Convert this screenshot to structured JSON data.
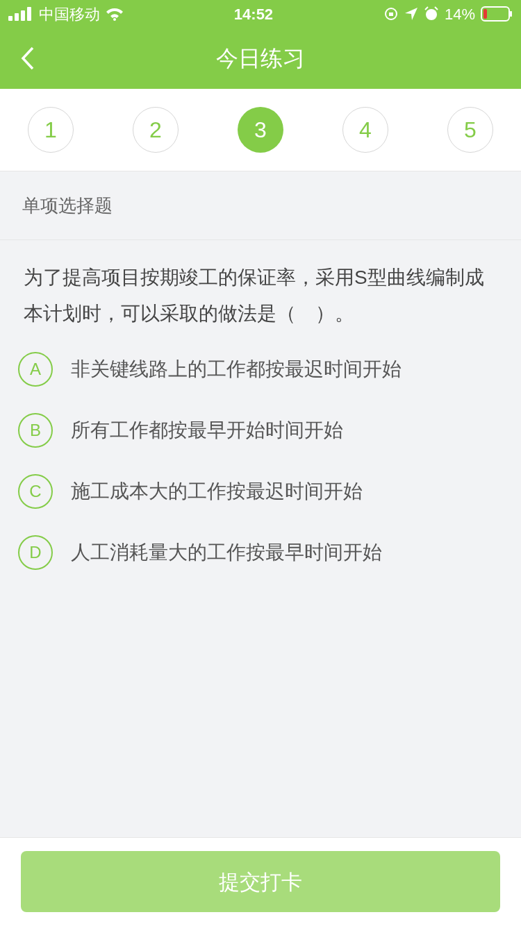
{
  "status_bar": {
    "carrier": "中国移动",
    "time": "14:52",
    "battery": "14%"
  },
  "header": {
    "title": "今日练习"
  },
  "steps": [
    {
      "label": "1",
      "selected": false
    },
    {
      "label": "2",
      "selected": false
    },
    {
      "label": "3",
      "selected": true
    },
    {
      "label": "4",
      "selected": false
    },
    {
      "label": "5",
      "selected": false
    }
  ],
  "question": {
    "type": "单项选择题",
    "text": "为了提高项目按期竣工的保证率，采用S型曲线编制成本计划时，可以采取的做法是（　）。",
    "options": [
      {
        "letter": "A",
        "text": "非关键线路上的工作都按最迟时间开始",
        "selected": false
      },
      {
        "letter": "B",
        "text": "所有工作都按最早开始时间开始",
        "selected": false
      },
      {
        "letter": "C",
        "text": "施工成本大的工作按最迟时间开始",
        "selected": false
      },
      {
        "letter": "D",
        "text": "人工消耗量大的工作按最早时间开始",
        "selected": false
      }
    ]
  },
  "submit": {
    "label": "提交打卡",
    "disabled": true
  }
}
